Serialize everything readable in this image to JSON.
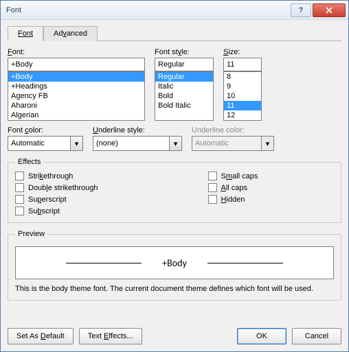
{
  "title": "Font",
  "tabs": {
    "font": "Font",
    "advanced": "Advanced"
  },
  "labels": {
    "font": "Font:",
    "style": "Font style:",
    "size": "Size:",
    "font_color": "Font color:",
    "underline_style": "Underline style:",
    "underline_color": "Underline color:"
  },
  "font": {
    "value": "+Body",
    "options": [
      "+Body",
      "+Headings",
      "Agency FB",
      "Aharoni",
      "Algerian"
    ]
  },
  "style": {
    "value": "Regular",
    "options": [
      "Regular",
      "Italic",
      "Bold",
      "Bold Italic"
    ]
  },
  "size": {
    "value": "11",
    "options": [
      "8",
      "9",
      "10",
      "11",
      "12"
    ]
  },
  "font_color": "Automatic",
  "underline_style": "(none)",
  "underline_color": "Automatic",
  "effects": {
    "legend": "Effects",
    "strikethrough": "Strikethrough",
    "double_strike": "Double strikethrough",
    "superscript": "Superscript",
    "subscript": "Subscript",
    "small_caps": "Small caps",
    "all_caps": "All caps",
    "hidden": "Hidden"
  },
  "preview": {
    "legend": "Preview",
    "sample": "+Body",
    "note": "This is the body theme font. The current document theme defines which font will be used."
  },
  "buttons": {
    "set_default": "Set As Default",
    "text_effects": "Text Effects...",
    "ok": "OK",
    "cancel": "Cancel"
  }
}
